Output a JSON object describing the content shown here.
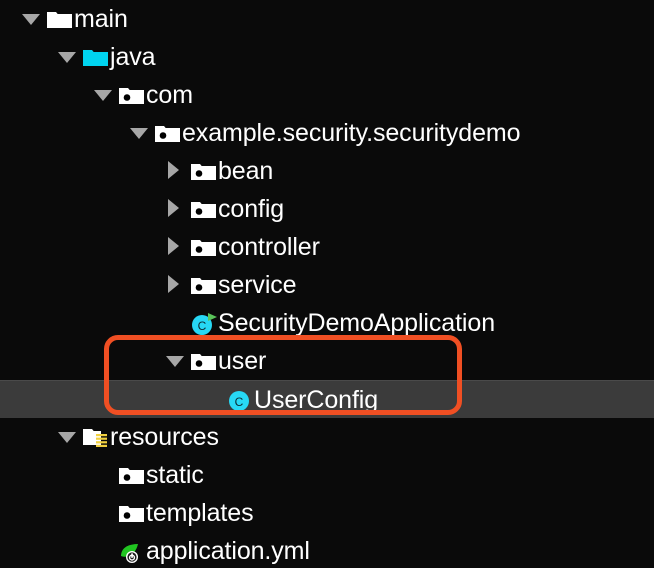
{
  "theme": {
    "background": "#0a0a0a",
    "text_color": "#ffffff",
    "selection_background": "#3b3b3b",
    "arrow_color": "#a7a7a7",
    "highlight_border_color": "#f04f23",
    "folder_white": "#ffffff",
    "folder_source_cyan": "#00d4f0",
    "class_icon_cyan": "#27d8f5",
    "resources_stripe_yellow": "#f2d13f",
    "run_arrow_green": "#5ac45a",
    "spring_leaf_green": "#21c521"
  },
  "tree": {
    "name": "project-tree",
    "rows": [
      {
        "label": "main",
        "indent": 0,
        "twisty": "down",
        "icon": "folder-white-icon",
        "selected": false
      },
      {
        "label": "java",
        "indent": 1,
        "twisty": "down",
        "icon": "folder-source-icon",
        "selected": false
      },
      {
        "label": "com",
        "indent": 2,
        "twisty": "down",
        "icon": "package-icon",
        "selected": false
      },
      {
        "label": "example.security.securitydemo",
        "indent": 3,
        "twisty": "down",
        "icon": "package-icon",
        "selected": false
      },
      {
        "label": "bean",
        "indent": 4,
        "twisty": "right",
        "icon": "package-icon",
        "selected": false
      },
      {
        "label": "config",
        "indent": 4,
        "twisty": "right",
        "icon": "package-icon",
        "selected": false
      },
      {
        "label": "controller",
        "indent": 4,
        "twisty": "right",
        "icon": "package-icon",
        "selected": false
      },
      {
        "label": "service",
        "indent": 4,
        "twisty": "right",
        "icon": "package-icon",
        "selected": false
      },
      {
        "label": "SecurityDemoApplication",
        "indent": 4,
        "twisty": "none",
        "icon": "runnable-class-icon",
        "selected": false
      },
      {
        "label": "user",
        "indent": 4,
        "twisty": "down",
        "icon": "package-icon",
        "selected": false
      },
      {
        "label": "UserConfig",
        "indent": 5,
        "twisty": "none",
        "icon": "class-icon",
        "selected": true
      },
      {
        "label": "resources",
        "indent": 1,
        "twisty": "down",
        "icon": "resources-folder-icon",
        "selected": false
      },
      {
        "label": "static",
        "indent": 2,
        "twisty": "none",
        "icon": "package-icon",
        "selected": false
      },
      {
        "label": "templates",
        "indent": 2,
        "twisty": "none",
        "icon": "package-icon",
        "selected": false
      },
      {
        "label": "application.yml",
        "indent": 2,
        "twisty": "none",
        "icon": "spring-yaml-icon",
        "selected": false
      }
    ]
  },
  "annotation": {
    "name": "highlight-box",
    "shape": "rounded-rectangle",
    "color": "#f04f23",
    "encloses": [
      "user",
      "UserConfig"
    ]
  }
}
